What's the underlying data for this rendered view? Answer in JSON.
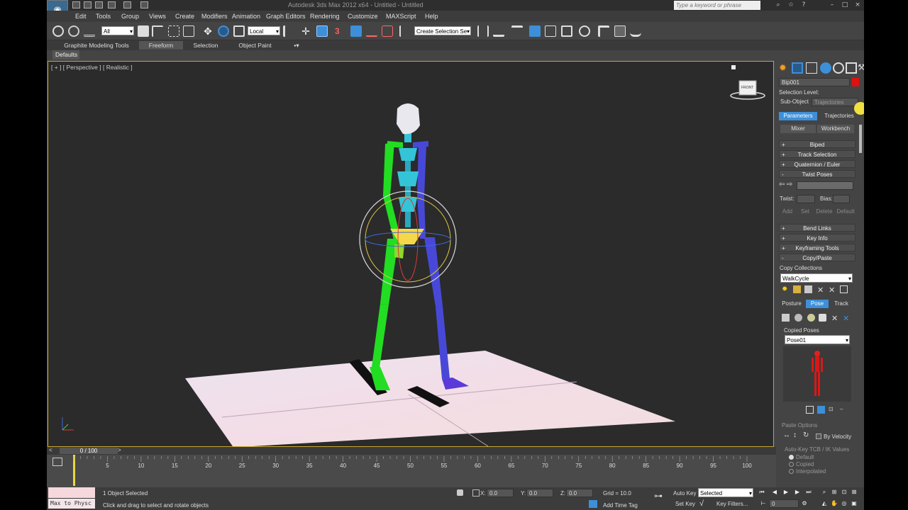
{
  "titlebar": {
    "document_title": "Autodesk 3ds Max 2012 x64  -  Untitled  -  Untitled",
    "search_placeholder": "Type a keyword or phrase",
    "app_logo": "3ds Max"
  },
  "menu": [
    "Edit",
    "Tools",
    "Group",
    "Views",
    "Create",
    "Modifiers",
    "Animation",
    "Graph Editors",
    "Rendering",
    "Customize",
    "MAXScript",
    "Help"
  ],
  "toolbar": {
    "selection_filter": "All",
    "reference_coord": "Local",
    "snap_label": "3",
    "selection_set": "Create Selection Se"
  },
  "ribbon": {
    "tabs": [
      "Graphite Modeling Tools",
      "Freeform",
      "Selection",
      "Object Paint"
    ],
    "active_tab": "Freeform",
    "defaults_label": "Defaults"
  },
  "viewport": {
    "label": "[ + ] [ Perspective ] [ Realistic ]",
    "viewcube_label": "FRONT"
  },
  "command_panel": {
    "object_name": "Bip001",
    "selection_level_label": "Selection Level:",
    "sub_object_label": "Sub-Object",
    "sub_object_value": "Trajectories",
    "tabs": [
      "Parameters",
      "Trajectories"
    ],
    "mixer_label": "Mixer",
    "workbench_label": "Workbench",
    "rollouts_top": [
      {
        "sign": "+",
        "label": "Biped"
      },
      {
        "sign": "+",
        "label": "Track Selection"
      },
      {
        "sign": "+",
        "label": "Quaternion / Euler"
      },
      {
        "sign": "-",
        "label": "Twist Poses"
      }
    ],
    "twist_label": "Twist:",
    "bias_label": "Bias:",
    "twist_buttons": [
      "Add",
      "Set",
      "Delete",
      "Default"
    ],
    "rollouts_mid": [
      {
        "sign": "+",
        "label": "Bend Links"
      },
      {
        "sign": "+",
        "label": "Key Info"
      },
      {
        "sign": "+",
        "label": "Keyframing Tools"
      },
      {
        "sign": "-",
        "label": "Copy/Paste"
      }
    ],
    "copy_collections_label": "Copy Collections",
    "collection_value": "WalkCycle",
    "copy_modes": [
      "Posture",
      "Pose",
      "Track"
    ],
    "active_copy_mode": "Pose",
    "copied_poses_label": "Copied Poses",
    "pose_value": "Pose01",
    "paste_options_label": "Paste Options",
    "by_velocity_label": "By Velocity",
    "auto_key_label": "Auto-Key TCB / IK Values",
    "radio_options": [
      "Default",
      "Copied",
      "Interpolated"
    ]
  },
  "timeline": {
    "slider_label": "0 / 100",
    "ticks": [
      "5",
      "10",
      "15",
      "20",
      "25",
      "30",
      "35",
      "40",
      "45",
      "50",
      "55",
      "60",
      "65",
      "70",
      "75",
      "80",
      "85",
      "90",
      "95",
      "100"
    ]
  },
  "statusbar": {
    "maxscript_label": "Max to Physc",
    "selected_status": "1 Object Selected",
    "prompt": "Click and drag to select and rotate objects",
    "x_label": "X:",
    "x_value": "0.0",
    "y_label": "Y:",
    "y_value": "0.0",
    "z_label": "Z:",
    "z_value": "0.0",
    "grid_label": "Grid = 10.0",
    "add_time_tag": "Add Time Tag",
    "auto_key": "Auto Key",
    "set_key": "Set Key",
    "selected_dropdown": "Selected",
    "key_filters": "Key Filters...",
    "frame_value": "0"
  },
  "colors": {
    "active_blue": "#3d8fd8",
    "viewport_border": "#c8a632",
    "biped_left": "#22dd22",
    "biped_right": "#4848d8",
    "biped_spine": "#33c4d8",
    "object_color": "#e01010"
  }
}
